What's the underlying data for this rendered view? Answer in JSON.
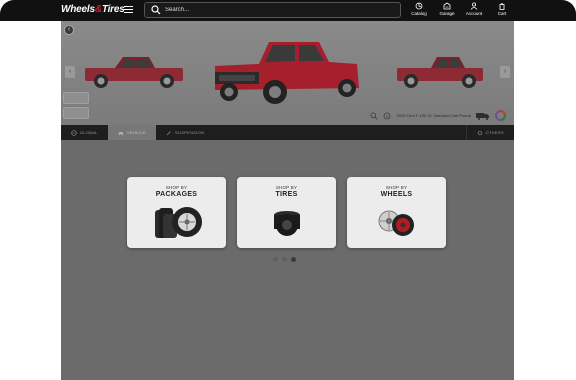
{
  "header": {
    "logo": {
      "part1": "Wheels",
      "amp": "&",
      "part2": "Tires"
    },
    "search": {
      "placeholder": "Search...",
      "value": ""
    },
    "nav": [
      {
        "label": "Catalog",
        "icon": "catalog-icon"
      },
      {
        "label": "Garage",
        "icon": "garage-icon"
      },
      {
        "label": "Account",
        "icon": "account-icon"
      },
      {
        "label": "Cart",
        "icon": "cart-icon"
      }
    ]
  },
  "hero": {
    "vehicle_name": "2024 Ford F-150 XL Standard Cab Pickup",
    "truck_color": "#b21f2d"
  },
  "tabs": [
    {
      "label": "GLOBAL",
      "icon": "globe-icon",
      "active": false
    },
    {
      "label": "VEHICLE",
      "icon": "car-icon",
      "active": true
    },
    {
      "label": "SUSPENSION",
      "icon": "wrench-icon",
      "active": false
    },
    {
      "label": "OTHERS",
      "icon": "settings-icon",
      "active": false
    }
  ],
  "shop_cards": [
    {
      "pre": "SHOP BY",
      "title": "PACKAGES"
    },
    {
      "pre": "SHOP BY",
      "title": "TIRES"
    },
    {
      "pre": "SHOP BY",
      "title": "WHEELS"
    }
  ],
  "carousel": {
    "page_count": 3,
    "active_index": 2
  },
  "colors": {
    "accent": "#e31b23",
    "overlay": "#6b6b6b",
    "topbar": "#111111"
  }
}
